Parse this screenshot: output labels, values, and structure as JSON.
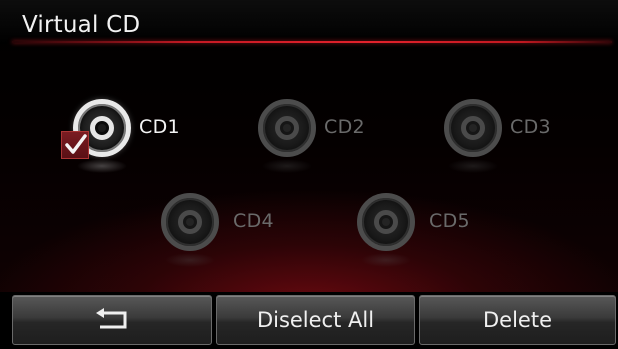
{
  "header": {
    "title": "Virtual CD"
  },
  "discs": [
    {
      "label": "CD1",
      "state": "selected"
    },
    {
      "label": "CD2",
      "state": "inactive"
    },
    {
      "label": "CD3",
      "state": "inactive"
    },
    {
      "label": "CD4",
      "state": "inactive"
    },
    {
      "label": "CD5",
      "state": "inactive"
    }
  ],
  "toolbar": {
    "back_icon": "return-arrow-icon",
    "deselect_label": "Diselect All",
    "delete_label": "Delete"
  },
  "colors": {
    "accent_red": "#c61a24",
    "text_active": "#f4f4f4",
    "text_inactive": "#6a6a6a"
  }
}
